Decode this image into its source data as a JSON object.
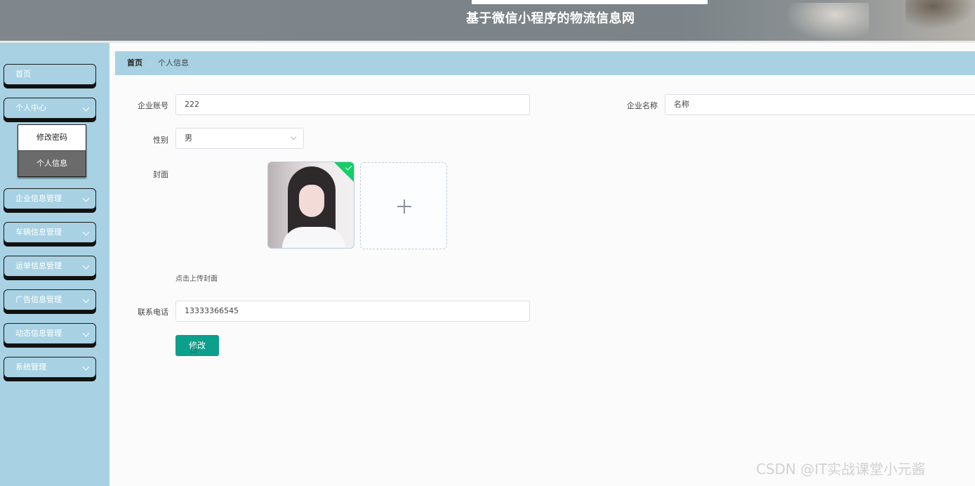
{
  "header": {
    "title": "基于微信小程序的物流信息网"
  },
  "sidebar": {
    "items": [
      {
        "label": "首页",
        "has_arrow": false
      },
      {
        "label": "个人中心",
        "has_arrow": true
      },
      {
        "label": "企业信息管理",
        "has_arrow": true
      },
      {
        "label": "车辆信息管理",
        "has_arrow": true
      },
      {
        "label": "运单信息管理",
        "has_arrow": true
      },
      {
        "label": "广告信息管理",
        "has_arrow": true
      },
      {
        "label": "动态信息管理",
        "has_arrow": true
      },
      {
        "label": "系统管理",
        "has_arrow": true
      }
    ],
    "submenu": [
      {
        "label": "修改密码",
        "active": false
      },
      {
        "label": "个人信息",
        "active": true
      }
    ]
  },
  "breadcrumb": {
    "home": "首页",
    "separator": "/",
    "current": "个人信息"
  },
  "form": {
    "account_label": "企业账号",
    "account_value": "222",
    "name_label": "企业名称",
    "name_value": "名称",
    "gender_label": "性别",
    "gender_value": "男",
    "cover_label": "封面",
    "cover_hint": "点击上传封面",
    "phone_label": "联系电话",
    "phone_value": "13333366545",
    "submit_label": "修改"
  },
  "watermark": "CSDN @IT实战课堂小元酱",
  "colors": {
    "sidebar": "#a8d2e3",
    "button": "#0c9f8b",
    "upload_success": "#13ce66"
  }
}
